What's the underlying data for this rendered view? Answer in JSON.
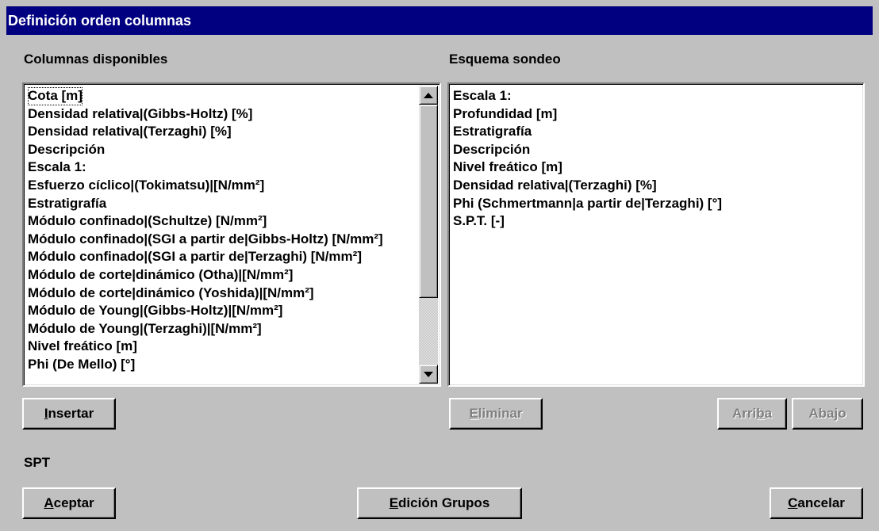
{
  "window": {
    "title": "Definición orden columnas"
  },
  "available": {
    "label": "Columnas disponibles",
    "items": [
      "Cota [m]",
      "Densidad relativa|(Gibbs-Holtz) [%]",
      "Densidad relativa|(Terzaghi) [%]",
      "Descripción",
      "Escala 1:",
      "Esfuerzo cíclico|(Tokimatsu)|[N/mm²]",
      "Estratigrafía",
      "Módulo confinado|(Schultze) [N/mm²]",
      "Módulo confinado|(SGI a partir de|Gibbs-Holtz) [N/mm²]",
      "Módulo confinado|(SGI a partir de|Terzaghi) [N/mm²]",
      "Módulo de corte|dinámico (Otha)|[N/mm²]",
      "Módulo de corte|dinámico (Yoshida)|[N/mm²]",
      "Módulo de Young|(Gibbs-Holtz)|[N/mm²]",
      "Módulo de Young|(Terzaghi)|[N/mm²]",
      "Nivel freático [m]",
      "Phi (De Mello) [°]"
    ]
  },
  "schema": {
    "label": "Esquema sondeo",
    "items": [
      "Escala 1:",
      "Profundidad [m]",
      "Estratigrafía",
      "Descripción",
      "Nivel freático [m]",
      "Densidad relativa|(Terzaghi) [%]",
      "Phi (Schmertmann|a partir de|Terzaghi) [°]",
      "S.P.T. [-]"
    ]
  },
  "buttons": {
    "insert": {
      "mnemonic": "I",
      "rest": "nsertar"
    },
    "delete": {
      "mnemonic": "E",
      "rest": "liminar"
    },
    "up": {
      "before": "Arri",
      "mnemonic": "b",
      "after": "a"
    },
    "down": {
      "before": "Aba",
      "mnemonic": "j",
      "after": "o"
    },
    "accept": {
      "mnemonic": "A",
      "rest": "ceptar"
    },
    "groups": {
      "mnemonic": "E",
      "rest": "dición Grupos"
    },
    "cancel": {
      "mnemonic": "C",
      "rest": "ancelar"
    }
  },
  "footer": {
    "spt_label": "SPT"
  }
}
